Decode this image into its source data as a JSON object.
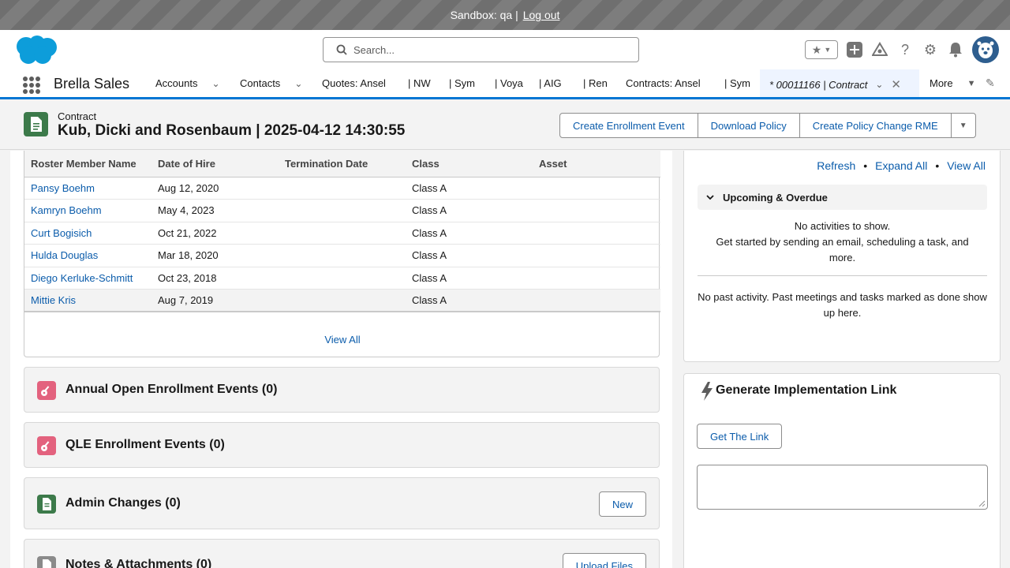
{
  "sandbox": {
    "text": "Sandbox: qa |",
    "logout": "Log out"
  },
  "search": {
    "placeholder": "Search..."
  },
  "nav": {
    "app_name": "Brella Sales",
    "items": [
      "Accounts",
      "Contacts",
      "Quotes: Ansel",
      "| NW",
      "| Sym",
      "| Voya",
      "| AIG",
      "| Ren",
      "Contracts: Ansel",
      "| Sym"
    ],
    "active_tab": "* 00011166 | Contract",
    "more": "More"
  },
  "record": {
    "object": "Contract",
    "title": "Kub, Dicki and Rosenbaum | 2025-04-12 14:30:55",
    "actions": [
      "Create Enrollment Event",
      "Download Policy",
      "Create Policy Change RME"
    ]
  },
  "roster": {
    "columns": [
      "Roster Member Name",
      "Date of Hire",
      "Termination Date",
      "Class",
      "Asset"
    ],
    "rows": [
      {
        "name": "Pansy Boehm",
        "hire": "Aug 12, 2020",
        "term": "",
        "class": "Class A",
        "asset": ""
      },
      {
        "name": "Kamryn Boehm",
        "hire": "May 4, 2023",
        "term": "",
        "class": "Class A",
        "asset": ""
      },
      {
        "name": "Curt Bogisich",
        "hire": "Oct 21, 2022",
        "term": "",
        "class": "Class A",
        "asset": ""
      },
      {
        "name": "Hulda Douglas",
        "hire": "Mar 18, 2020",
        "term": "",
        "class": "Class A",
        "asset": ""
      },
      {
        "name": "Diego Kerluke-Schmitt",
        "hire": "Oct 23, 2018",
        "term": "",
        "class": "Class A",
        "asset": ""
      },
      {
        "name": "Mittie Kris",
        "hire": "Aug 7, 2019",
        "term": "",
        "class": "Class A",
        "asset": ""
      }
    ],
    "view_all": "View All"
  },
  "related": {
    "annual": "Annual Open Enrollment Events (0)",
    "qle": "QLE Enrollment Events (0)",
    "admin": "Admin Changes (0)",
    "admin_button": "New",
    "notes": "Notes & Attachments (0)",
    "notes_button": "Upload Files"
  },
  "activity": {
    "refresh": "Refresh",
    "expand_all": "Expand All",
    "view_all": "View All",
    "upcoming": "Upcoming & Overdue",
    "no_activities": "No activities to show.",
    "get_started": "Get started by sending an email, scheduling a task, and more.",
    "past": "No past activity. Past meetings and tasks marked as done show up here."
  },
  "implementation": {
    "title": "Generate Implementation Link",
    "button": "Get The Link"
  },
  "colors": {
    "brand": "#0176d3",
    "link": "#0b5cab",
    "contract_icon": "#3c7a4a",
    "enroll_icon": "#e3627e"
  }
}
